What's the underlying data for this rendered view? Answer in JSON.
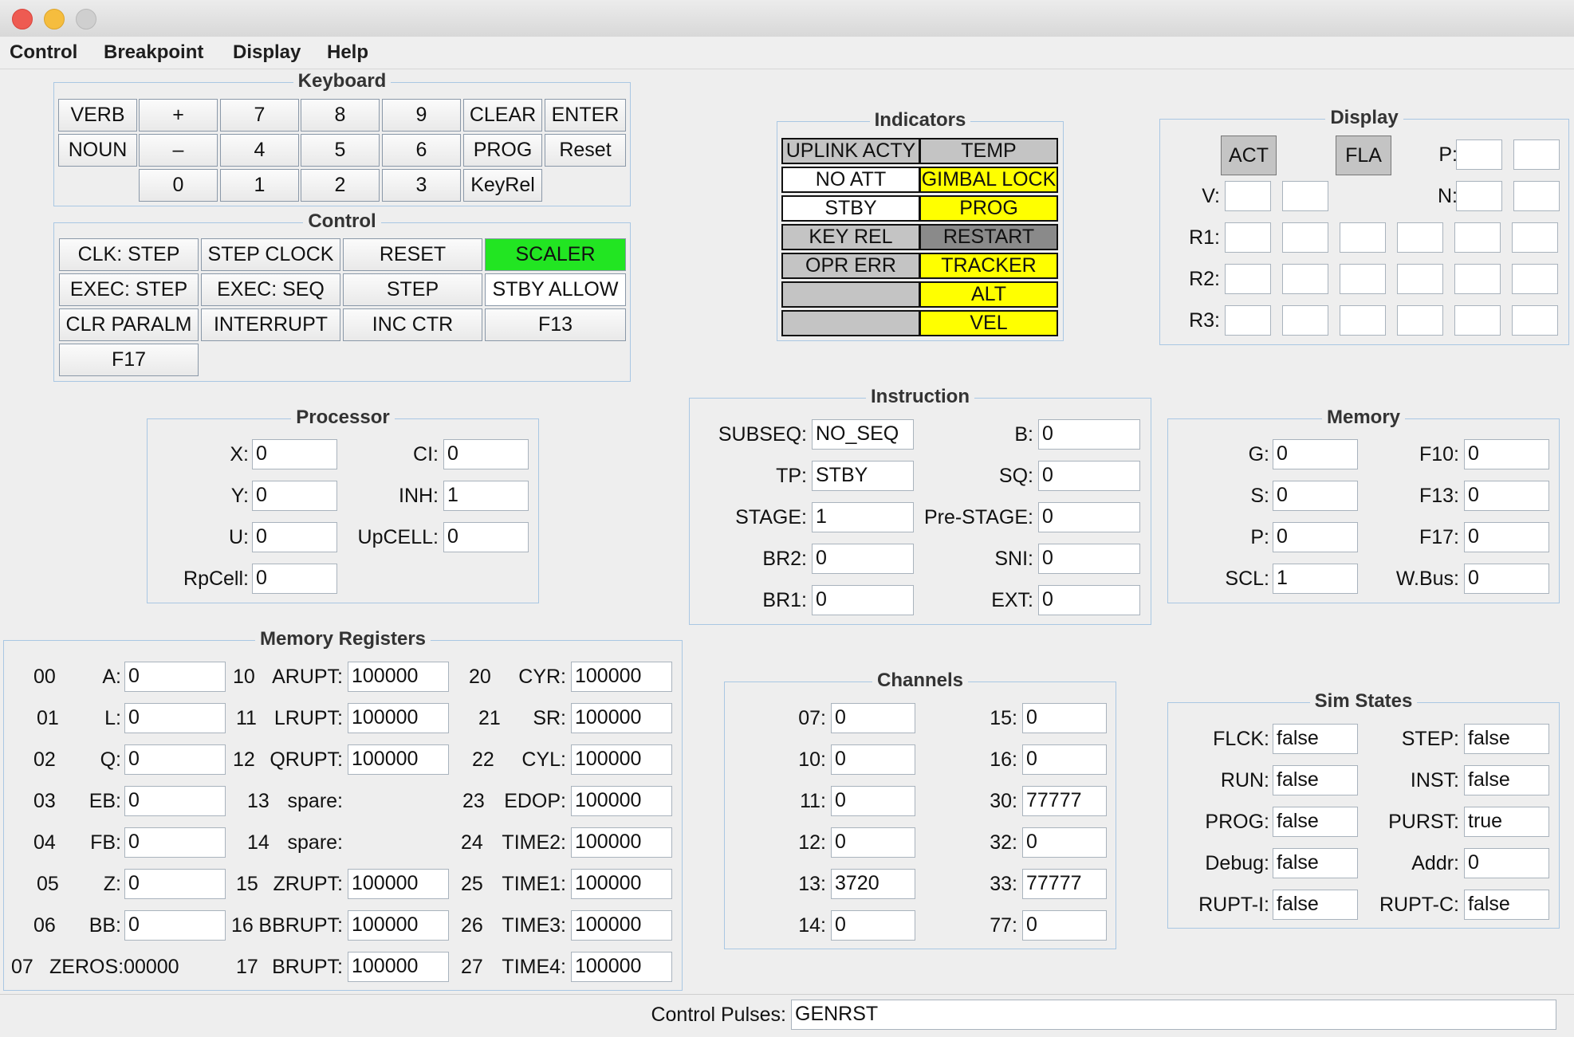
{
  "window": {
    "traffic_lights": [
      "#ee5b52",
      "#f5bd3e",
      "#cfcfcf"
    ]
  },
  "menu": [
    "Control",
    "Breakpoint",
    "Display",
    "Help"
  ],
  "keyboard": {
    "title": "Keyboard",
    "row1": [
      "VERB",
      "+",
      "7",
      "8",
      "9",
      "CLEAR",
      "ENTER"
    ],
    "row2": [
      "NOUN",
      "–",
      "4",
      "5",
      "6",
      "PROG",
      "Reset"
    ],
    "row3": [
      "0",
      "1",
      "2",
      "3",
      "KeyRel"
    ]
  },
  "control": {
    "title": "Control",
    "buttons": [
      "CLK: STEP",
      "STEP CLOCK",
      "RESET",
      "SCALER",
      "EXEC: STEP",
      "EXEC: SEQ",
      "STEP",
      "STBY ALLOW",
      "CLR PARALM",
      "INTERRUPT",
      "INC CTR",
      "F13",
      "F17"
    ],
    "active_color": "#22e522"
  },
  "indicators": {
    "title": "Indicators",
    "left": [
      "UPLINK ACTY",
      "NO ATT",
      "STBY",
      "KEY REL",
      "OPR ERR",
      "",
      ""
    ],
    "right": [
      "TEMP",
      "GIMBAL LOCK",
      "PROG",
      "RESTART",
      "TRACKER",
      "ALT",
      "VEL"
    ],
    "colors": {
      "off": "#c4c4c4",
      "white": "#ffffff",
      "yellow": "#ffff00",
      "dark": "#8a8a8a"
    }
  },
  "display": {
    "title": "Display",
    "act": "ACT",
    "fla": "FLA",
    "p_label": "P:",
    "v_label": "V:",
    "n_label": "N:",
    "r1_label": "R1:",
    "r2_label": "R2:",
    "r3_label": "R3:"
  },
  "processor": {
    "title": "Processor",
    "fields": [
      {
        "label": "X:",
        "value": "0"
      },
      {
        "label": "CI:",
        "value": "0"
      },
      {
        "label": "Y:",
        "value": "0"
      },
      {
        "label": "INH:",
        "value": "1"
      },
      {
        "label": "U:",
        "value": "0"
      },
      {
        "label": "UpCELL:",
        "value": "0"
      },
      {
        "label": "RpCell:",
        "value": "0"
      }
    ]
  },
  "instruction": {
    "title": "Instruction",
    "fields": [
      {
        "label": "SUBSEQ:",
        "value": "NO_SEQ"
      },
      {
        "label": "B:",
        "value": "0"
      },
      {
        "label": "TP:",
        "value": "STBY"
      },
      {
        "label": "SQ:",
        "value": "0"
      },
      {
        "label": "STAGE:",
        "value": "1"
      },
      {
        "label": "Pre-STAGE:",
        "value": "0"
      },
      {
        "label": "BR2:",
        "value": "0"
      },
      {
        "label": "SNI:",
        "value": "0"
      },
      {
        "label": "BR1:",
        "value": "0"
      },
      {
        "label": "EXT:",
        "value": "0"
      }
    ]
  },
  "memory": {
    "title": "Memory",
    "fields": [
      {
        "label": "G:",
        "value": "0"
      },
      {
        "label": "F10:",
        "value": "0"
      },
      {
        "label": "S:",
        "value": "0"
      },
      {
        "label": "F13:",
        "value": "0"
      },
      {
        "label": "P:",
        "value": "0"
      },
      {
        "label": "F17:",
        "value": "0"
      },
      {
        "label": "SCL:",
        "value": "1"
      },
      {
        "label": "W.Bus:",
        "value": "0"
      }
    ]
  },
  "memregs": {
    "title": "Memory Registers",
    "col1": [
      {
        "num": "00",
        "label": "A:",
        "value": "0"
      },
      {
        "num": "01",
        "label": "L:",
        "value": "0"
      },
      {
        "num": "02",
        "label": "Q:",
        "value": "0"
      },
      {
        "num": "03",
        "label": "EB:",
        "value": "0"
      },
      {
        "num": "04",
        "label": "FB:",
        "value": "0"
      },
      {
        "num": "05",
        "label": "Z:",
        "value": "0"
      },
      {
        "num": "06",
        "label": "BB:",
        "value": "0"
      }
    ],
    "zeros": {
      "num": "07",
      "label": "ZEROS:00000"
    },
    "col2": [
      {
        "num": "10",
        "label": "ARUPT:",
        "value": "100000"
      },
      {
        "num": "11",
        "label": "LRUPT:",
        "value": "100000"
      },
      {
        "num": "12",
        "label": "QRUPT:",
        "value": "100000"
      },
      {
        "num": "13",
        "label": "spare:",
        "value": null
      },
      {
        "num": "14",
        "label": "spare:",
        "value": null
      },
      {
        "num": "15",
        "label": "ZRUPT:",
        "value": "100000"
      },
      {
        "num": "16",
        "label": "BBRUPT:",
        "value": "100000"
      },
      {
        "num": "17",
        "label": "BRUPT:",
        "value": "100000"
      }
    ],
    "col3": [
      {
        "num": "20",
        "label": "CYR:",
        "value": "100000"
      },
      {
        "num": "21",
        "label": "SR:",
        "value": "100000"
      },
      {
        "num": "22",
        "label": "CYL:",
        "value": "100000"
      },
      {
        "num": "23",
        "label": "EDOP:",
        "value": "100000"
      },
      {
        "num": "24",
        "label": "TIME2:",
        "value": "100000"
      },
      {
        "num": "25",
        "label": "TIME1:",
        "value": "100000"
      },
      {
        "num": "26",
        "label": "TIME3:",
        "value": "100000"
      },
      {
        "num": "27",
        "label": "TIME4:",
        "value": "100000"
      }
    ]
  },
  "channels": {
    "title": "Channels",
    "fields": [
      {
        "label": "07:",
        "value": "0"
      },
      {
        "label": "15:",
        "value": "0"
      },
      {
        "label": "10:",
        "value": "0"
      },
      {
        "label": "16:",
        "value": "0"
      },
      {
        "label": "11:",
        "value": "0"
      },
      {
        "label": "30:",
        "value": "77777"
      },
      {
        "label": "12:",
        "value": "0"
      },
      {
        "label": "32:",
        "value": "0"
      },
      {
        "label": "13:",
        "value": "3720"
      },
      {
        "label": "33:",
        "value": "77777"
      },
      {
        "label": "14:",
        "value": "0"
      },
      {
        "label": "77:",
        "value": "0"
      }
    ]
  },
  "simstates": {
    "title": "Sim States",
    "fields": [
      {
        "label": "FLCK:",
        "value": "false"
      },
      {
        "label": "STEP:",
        "value": "false"
      },
      {
        "label": "RUN:",
        "value": "false"
      },
      {
        "label": "INST:",
        "value": "false"
      },
      {
        "label": "PROG:",
        "value": "false"
      },
      {
        "label": "PURST:",
        "value": "true"
      },
      {
        "label": "Debug:",
        "value": "false"
      },
      {
        "label": "Addr:",
        "value": "0"
      },
      {
        "label": "RUPT-I:",
        "value": "false"
      },
      {
        "label": "RUPT-C:",
        "value": "false"
      }
    ]
  },
  "status": {
    "label": "Control Pulses:",
    "value": "GENRST"
  }
}
